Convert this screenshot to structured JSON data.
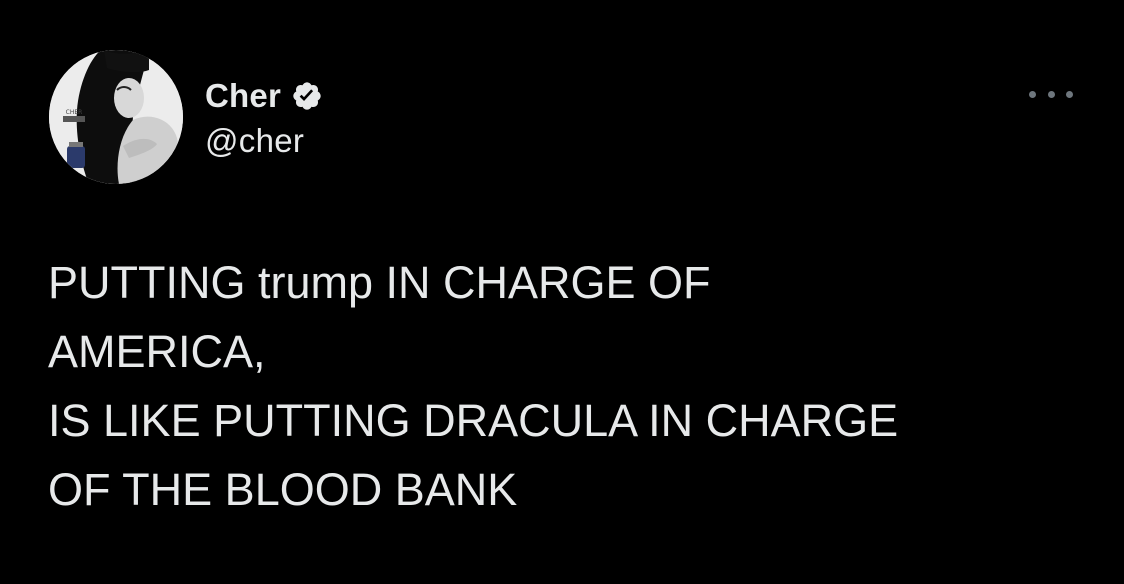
{
  "author": {
    "name": "Cher",
    "handle": "@cher",
    "verified": true,
    "avatar_icon": "profile-photo",
    "verified_icon": "verified-badge-icon"
  },
  "menu": {
    "icon": "more-options-icon"
  },
  "tweet": {
    "lines": [
      "PUTTING trump IN CHARGE OF",
      "AMERICA,",
      "IS LIKE PUTTING DRACULA IN CHARGE",
      "OF THE BLOOD BANK"
    ]
  },
  "colors": {
    "background": "#000000",
    "text": "#e7e9ea",
    "muted": "#6e767d"
  }
}
